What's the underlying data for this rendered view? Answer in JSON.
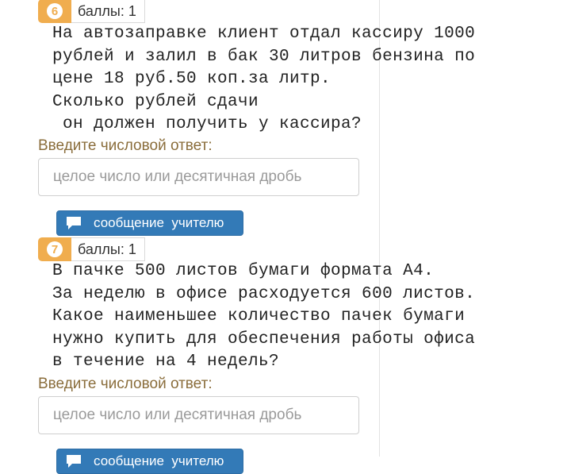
{
  "questions": [
    {
      "number": "6",
      "points": "баллы: 1",
      "lines": [
        "На автозаправке клиент отдал кассиру 1000",
        "рублей и залил в бак 30 литров бензина по",
        "цене 18 руб.50 коп.за литр.",
        "Сколько рублей сдачи",
        " он должен получить у кассира?"
      ],
      "prompt": "Введите числовой ответ:",
      "placeholder": "целое число или десятичная дробь",
      "message_button": "сообщение  учителю"
    },
    {
      "number": "7",
      "points": "баллы: 1",
      "lines": [
        "В пачке 500 листов бумаги формата А4.",
        "За неделю в офисе расходуется 600 листов.",
        "Какое наименьшее количество пачек бумаги",
        "нужно купить для обеспечения работы офиса",
        "в течение на 4 недель?"
      ],
      "prompt": "Введите числовой ответ:",
      "placeholder": "целое число или десятичная дробь",
      "message_button": "сообщение  учителю"
    }
  ],
  "colors": {
    "badge": "#f0ad4e",
    "prompt": "#8a6d3b",
    "button": "#337ab7"
  },
  "icons": {
    "message": "speech-bubble-icon"
  }
}
